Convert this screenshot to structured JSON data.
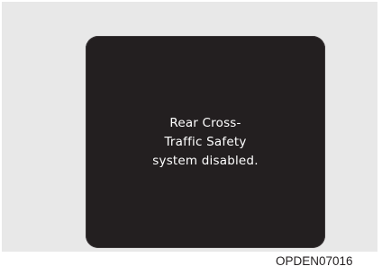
{
  "display": {
    "message_lines": [
      "Rear Cross-",
      "Traffic Safety",
      "system disabled."
    ],
    "screen_color": "#231f20",
    "text_color": "#ffffff"
  },
  "figure": {
    "code": "OPDEN07016"
  }
}
